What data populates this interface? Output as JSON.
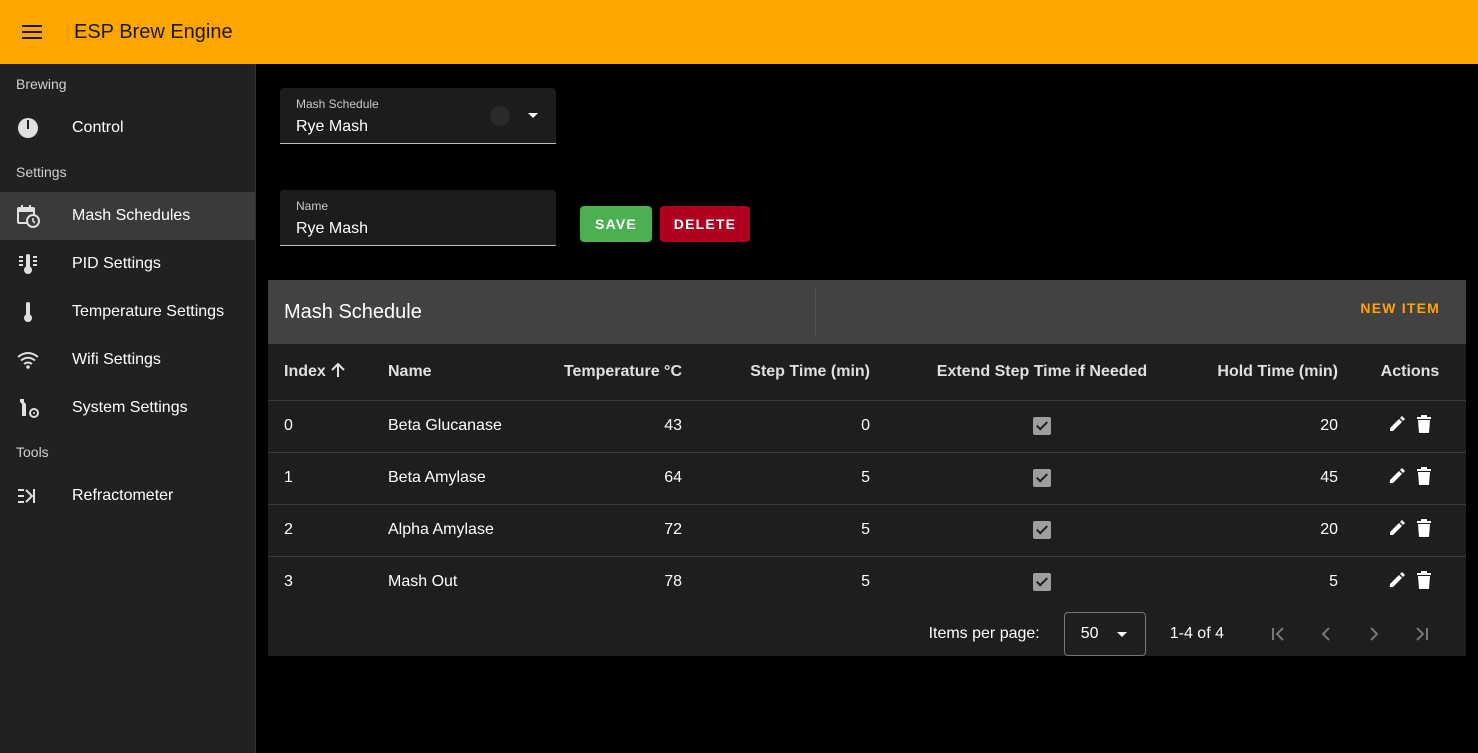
{
  "app": {
    "title": "ESP Brew Engine"
  },
  "sidebar": {
    "sections": [
      {
        "header": "Brewing",
        "items": [
          {
            "label": "Control",
            "icon": "gauge-icon"
          }
        ]
      },
      {
        "header": "Settings",
        "items": [
          {
            "label": "Mash Schedules",
            "icon": "calendar-clock-icon",
            "active": true
          },
          {
            "label": "PID Settings",
            "icon": "thermometer-lines-icon"
          },
          {
            "label": "Temperature Settings",
            "icon": "thermometer-icon"
          },
          {
            "label": "Wifi Settings",
            "icon": "wifi-icon"
          },
          {
            "label": "System Settings",
            "icon": "tools-cog-icon"
          }
        ]
      },
      {
        "header": "Tools",
        "items": [
          {
            "label": "Refractometer",
            "icon": "refractometer-icon"
          }
        ]
      }
    ]
  },
  "schedule_select": {
    "label": "Mash Schedule",
    "value": "Rye Mash"
  },
  "name_field": {
    "label": "Name",
    "value": "Rye Mash"
  },
  "buttons": {
    "save": "SAVE",
    "delete": "DELETE"
  },
  "table": {
    "title": "Mash Schedule",
    "new_item": "NEW ITEM",
    "columns": {
      "index": "Index",
      "name": "Name",
      "temperature": "Temperature °C",
      "step_time": "Step Time (min)",
      "extend": "Extend Step Time if Needed",
      "hold_time": "Hold Time (min)",
      "actions": "Actions"
    },
    "rows": [
      {
        "index": "0",
        "name": "Beta Glucanase",
        "temperature": "43",
        "step_time": "0",
        "extend": true,
        "hold_time": "20"
      },
      {
        "index": "1",
        "name": "Beta Amylase",
        "temperature": "64",
        "step_time": "5",
        "extend": true,
        "hold_time": "45"
      },
      {
        "index": "2",
        "name": "Alpha Amylase",
        "temperature": "72",
        "step_time": "5",
        "extend": true,
        "hold_time": "20"
      },
      {
        "index": "3",
        "name": "Mash Out",
        "temperature": "78",
        "step_time": "5",
        "extend": true,
        "hold_time": "5"
      }
    ],
    "footer": {
      "items_per_page_label": "Items per page:",
      "items_per_page": "50",
      "range": "1-4 of 4"
    }
  },
  "colors": {
    "accent": "#ffa500",
    "save": "#4caf50",
    "delete": "#b00020"
  }
}
